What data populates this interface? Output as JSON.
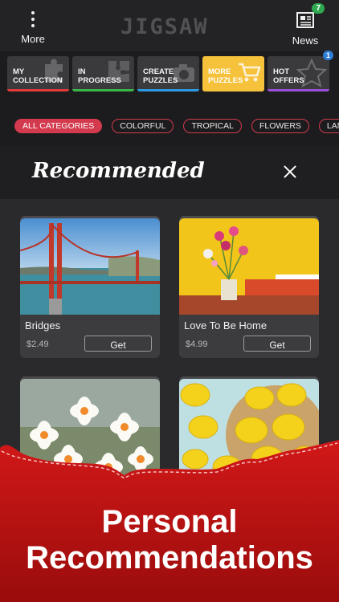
{
  "header": {
    "more_label": "More",
    "logo_text": "JIGSAW",
    "news_label": "News",
    "news_badge": "7"
  },
  "tiles": [
    {
      "label": "MY\nCOLLECTION",
      "line1": "MY",
      "line2": "COLLECTION",
      "accent": "#e23a3a"
    },
    {
      "label": "IN\nPROGRESS",
      "line1": "IN",
      "line2": "PROGRESS",
      "accent": "#39b54a"
    },
    {
      "label": "CREATE\nPUZZLES",
      "line1": "CREATE",
      "line2": "PUZZLES",
      "accent": "#2a9be0"
    },
    {
      "label": "MORE\nPUZZLES",
      "line1": "MORE",
      "line2": "PUZZLES",
      "accent": "#f6c23c"
    },
    {
      "label": "HOT\nOFFERS",
      "line1": "HOT",
      "line2": "OFFERS",
      "accent": "#9b4fd6"
    }
  ],
  "hot_offers_badge": "1",
  "chips": [
    "ALL CATEGORIES",
    "COLORFUL",
    "TROPICAL",
    "FLOWERS",
    "LAN"
  ],
  "recommended": {
    "title": "Recommended",
    "cards": [
      {
        "title": "Bridges",
        "price": "$2.49",
        "action": "Get"
      },
      {
        "title": "Love To Be Home",
        "price": "$4.99",
        "action": "Get"
      }
    ]
  },
  "banner": {
    "line1": "Personal",
    "line2": "Recommendations"
  },
  "colors": {
    "accent_red": "#d43a4e",
    "background": "#1c1c1e"
  }
}
